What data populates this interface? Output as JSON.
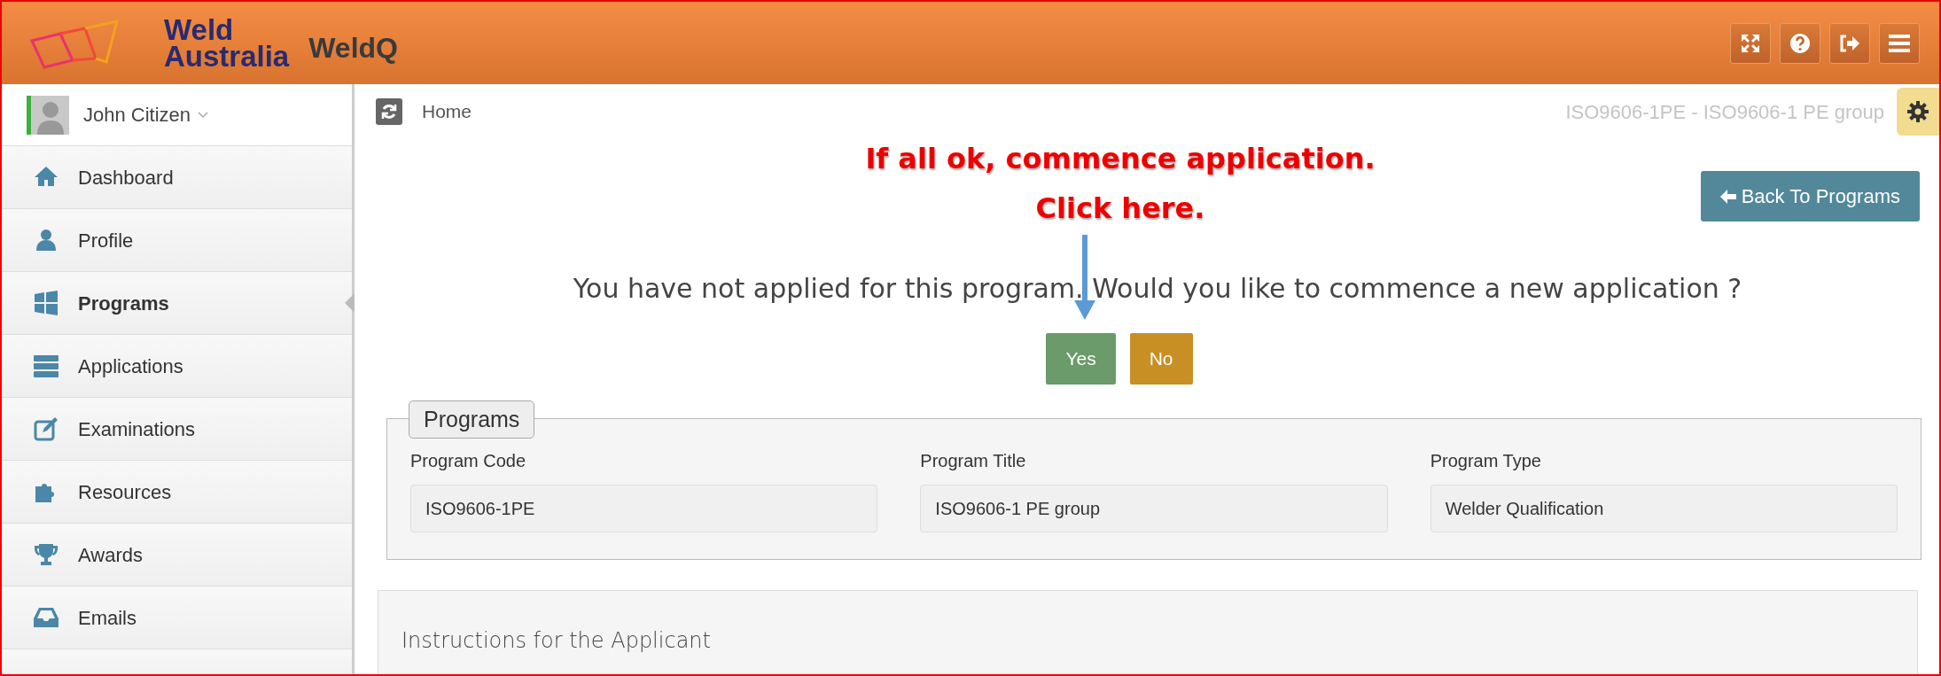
{
  "header": {
    "brand_line_1": "Weld",
    "brand_line_2": "Australia",
    "app_name": "WeldQ"
  },
  "user": {
    "name": "John Citizen"
  },
  "sidebar": {
    "items": [
      {
        "label": "Dashboard",
        "kind": "home",
        "selected": false
      },
      {
        "label": "Profile",
        "kind": "person",
        "selected": false
      },
      {
        "label": "Programs",
        "kind": "windows",
        "selected": true
      },
      {
        "label": "Applications",
        "kind": "stack",
        "selected": false
      },
      {
        "label": "Examinations",
        "kind": "edit",
        "selected": false
      },
      {
        "label": "Resources",
        "kind": "puzzle",
        "selected": false
      },
      {
        "label": "Awards",
        "kind": "trophy",
        "selected": false
      },
      {
        "label": "Emails",
        "kind": "inbox",
        "selected": false
      }
    ]
  },
  "breadcrumb": "Home",
  "page_title": "ISO9606-1PE - ISO9606-1 PE group",
  "annotation": {
    "line_1": "If all ok, commence application.",
    "line_2": "Click here."
  },
  "back_button": "Back To Programs",
  "question": "You have not applied for this program. Would you like to commence a new application ?",
  "buttons": [
    {
      "label": "Yes",
      "kind": "confirm"
    },
    {
      "label": "No",
      "kind": "decline"
    }
  ],
  "programs": {
    "legend": "Programs",
    "fields": [
      {
        "label": "Program Code",
        "value": "ISO9606-1PE"
      },
      {
        "label": "Program Title",
        "value": "ISO9606-1 PE group"
      },
      {
        "label": "Program Type",
        "value": "Welder Qualification"
      }
    ]
  },
  "instructions": {
    "title": "Instructions for the Applicant"
  }
}
